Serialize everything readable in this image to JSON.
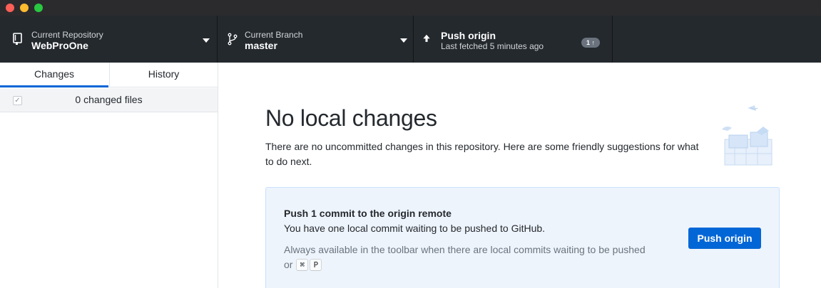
{
  "toolbar": {
    "repository": {
      "label": "Current Repository",
      "value": "WebProOne"
    },
    "branch": {
      "label": "Current Branch",
      "value": "master"
    },
    "push": {
      "title": "Push origin",
      "subtitle": "Last fetched 5 minutes ago",
      "badge": "1 ↑"
    }
  },
  "sidebar": {
    "tabs": [
      {
        "label": "Changes"
      },
      {
        "label": "History"
      }
    ],
    "changed_files": "0 changed files"
  },
  "main": {
    "heading": "No local changes",
    "description": "There are no uncommitted changes in this repository. Here are some friendly suggestions for what to do next.",
    "suggestion": {
      "title": "Push 1 commit to the origin remote",
      "description": "You have one local commit waiting to be pushed to GitHub.",
      "hint_prefix": "Always available in the toolbar when there are local commits waiting to be pushed or",
      "shortcut_keys": [
        "⌘",
        "P"
      ],
      "button_label": "Push origin"
    }
  },
  "colors": {
    "accent": "#0366d6",
    "toolbar_bg": "#24292e",
    "suggestion_bg": "#eef4fc"
  }
}
